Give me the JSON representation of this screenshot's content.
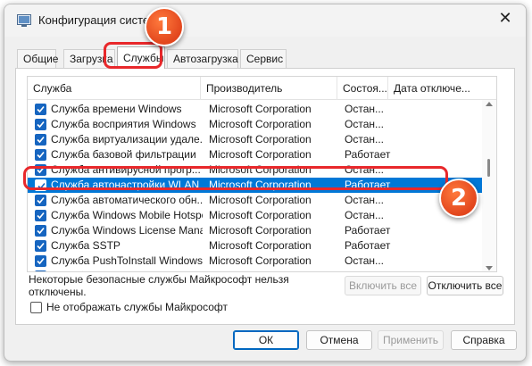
{
  "window": {
    "title": "Конфигурация системы",
    "close_icon": "close-icon"
  },
  "tabs": [
    {
      "label": "Общие"
    },
    {
      "label": "Загрузка"
    },
    {
      "label": "Службы",
      "active": true
    },
    {
      "label": "Автозагрузка"
    },
    {
      "label": "Сервис"
    }
  ],
  "list": {
    "columns": [
      "Служба",
      "Производитель",
      "Состоя...",
      "Дата отключе..."
    ],
    "rows": [
      {
        "name": "Служба времени Windows",
        "manufacturer": "Microsoft Corporation",
        "status": "Остан...",
        "checked": true
      },
      {
        "name": "Служба восприятия Windows",
        "manufacturer": "Microsoft Corporation",
        "status": "Остан...",
        "checked": true
      },
      {
        "name": "Служба виртуализации удале...",
        "manufacturer": "Microsoft Corporation",
        "status": "Остан...",
        "checked": true
      },
      {
        "name": "Служба базовой фильтрации",
        "manufacturer": "Microsoft Corporation",
        "status": "Работает",
        "checked": true
      },
      {
        "name": "Служба антивирусной прогр...",
        "manufacturer": "Microsoft Corporation",
        "status": "Остан...",
        "checked": true
      },
      {
        "name": "Служба автонастройки WLAN",
        "manufacturer": "Microsoft Corporation",
        "status": "Работает",
        "checked": true,
        "selected": true
      },
      {
        "name": "Служба автоматического обн...",
        "manufacturer": "Microsoft Corporation",
        "status": "Остан...",
        "checked": true
      },
      {
        "name": "Служба Windows Mobile Hotspot",
        "manufacturer": "Microsoft Corporation",
        "status": "Остан...",
        "checked": true
      },
      {
        "name": "Служба Windows License Manager",
        "manufacturer": "Microsoft Corporation",
        "status": "Работает",
        "checked": true
      },
      {
        "name": "Служба SSTP",
        "manufacturer": "Microsoft Corporation",
        "status": "Работает",
        "checked": true
      },
      {
        "name": "Служба PushToInstall Windows",
        "manufacturer": "Microsoft Corporation",
        "status": "Остан...",
        "checked": true
      },
      {
        "name": "Служба OpenXR для Windows",
        "manufacturer": "Microsoft Corporation",
        "status": "Остан...",
        "checked": true
      }
    ]
  },
  "note": {
    "line1": "Некоторые безопасные службы Майкрософт нельзя",
    "line2": "отключены."
  },
  "buttons": {
    "enable_all": "Включить все",
    "disable_all": "Отключить все",
    "ok": "ОК",
    "cancel": "Отмена",
    "apply": "Применить",
    "help": "Справка"
  },
  "hide_ms_label": "Не отображать службы Майкрософт",
  "badges": {
    "one": "1",
    "two": "2"
  },
  "colors": {
    "selection": "#0078d7",
    "highlight": "#e8282b",
    "badge": "#e2461d",
    "checkbox": "#1665c0"
  }
}
